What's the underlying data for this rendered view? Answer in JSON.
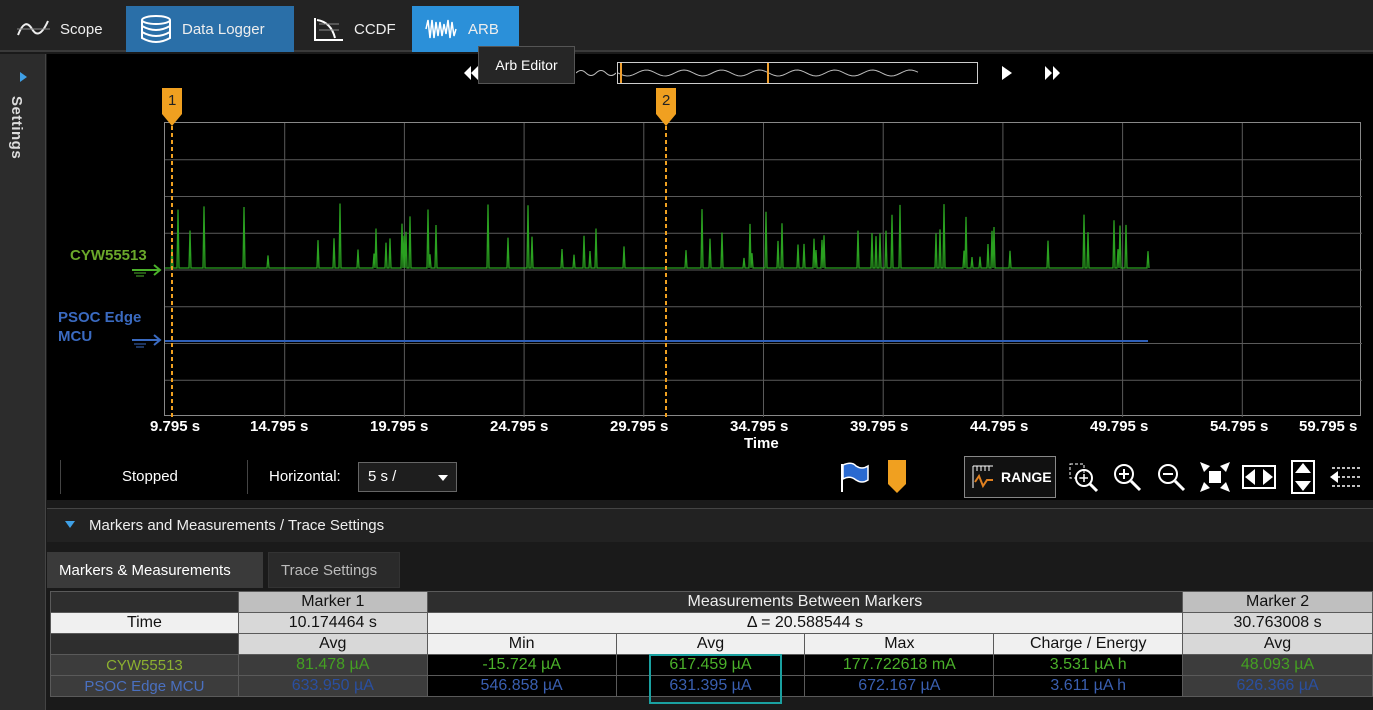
{
  "tabs": [
    {
      "label": "Scope",
      "icon": "waveform-icon"
    },
    {
      "label": "Data Logger",
      "icon": "database-icon"
    },
    {
      "label": "CCDF",
      "icon": "ccdf-icon"
    },
    {
      "label": "ARB",
      "icon": "arb-wave-icon"
    }
  ],
  "tooltip": "Arb Editor",
  "sidebar": {
    "label": "Settings"
  },
  "plot": {
    "x_ticks": [
      "9.795 s",
      "14.795 s",
      "19.795 s",
      "24.795 s",
      "29.795 s",
      "34.795 s",
      "39.795 s",
      "44.795 s",
      "49.795 s",
      "54.795 s",
      "59.795 s"
    ],
    "x_label": "Time",
    "markers": [
      {
        "label": "1"
      },
      {
        "label": "2"
      }
    ],
    "traces": [
      {
        "name": "CYW55513",
        "color": "#6aa82a"
      },
      {
        "name_line1": "PSOC Edge",
        "name_line2": "MCU",
        "color": "#3a6ac0"
      }
    ]
  },
  "controls": {
    "status": "Stopped",
    "horizontal_label": "Horizontal:",
    "horizontal_value": "5 s /",
    "range_label": "RANGE"
  },
  "panel": {
    "title": "Markers and Measurements / Trace Settings",
    "tab_markers": "Markers & Measurements",
    "tab_trace": "Trace Settings"
  },
  "table": {
    "marker1": "Marker 1",
    "between": "Measurements Between Markers",
    "marker2": "Marker 2",
    "time_label": "Time",
    "marker1_time": "10.174464 s",
    "delta": "Δ = 20.588544 s",
    "marker2_time": "30.763008 s",
    "cols": [
      "Avg",
      "Min",
      "Avg",
      "Max",
      "Charge / Energy",
      "Avg"
    ],
    "rows": [
      {
        "name": "CYW55513",
        "m1_avg": "81.478 µA",
        "min": "-15.724 µA",
        "avg": "617.459 µA",
        "max": "177.722618 mA",
        "charge": "3.531 µA h",
        "m2_avg": "48.093 µA"
      },
      {
        "name": "PSOC Edge MCU",
        "m1_avg": "633.950 µA",
        "min": "546.858 µA",
        "avg": "631.395 µA",
        "max": "672.167 µA",
        "charge": "3.611 µA h",
        "m2_avg": "626.366 µA"
      }
    ]
  }
}
